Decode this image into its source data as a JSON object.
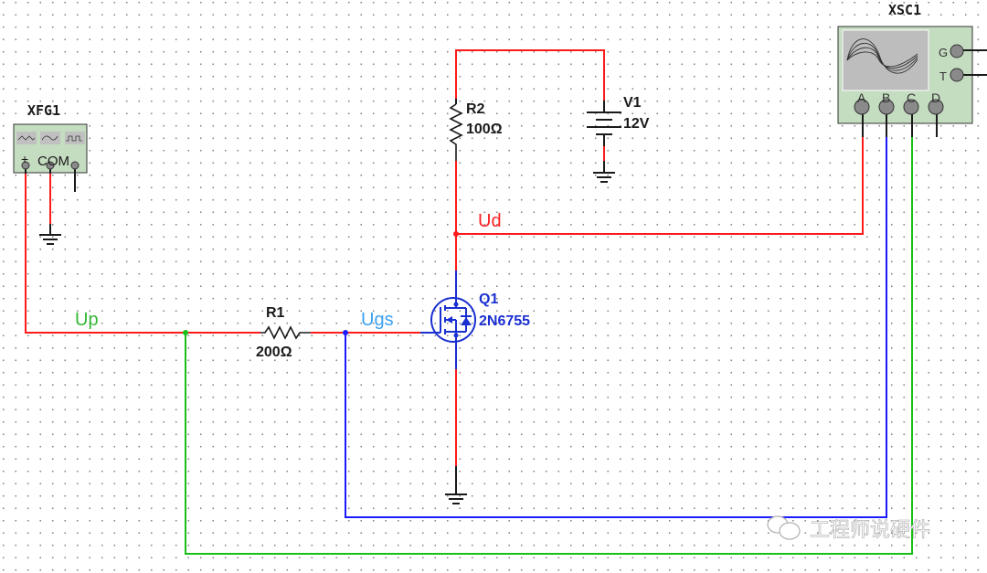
{
  "colors": {
    "wire_red": "#ff1a1a",
    "wire_blue": "#1a1aff",
    "wire_green": "#16c016",
    "component_black": "#1a1a1a",
    "mosfet_blue": "#1a2fd0",
    "label_up": "#33b833",
    "label_ugs": "#3ba0f0",
    "label_ud": "#ff2020",
    "instrument_fill": "#c4dcc0",
    "screen_fill": "#bdbdbd",
    "terminal_fill": "#8a8a8a",
    "watermark": "#b0b0b0"
  },
  "components": {
    "function_generator": {
      "name": "XFG1",
      "waveform_buttons": [
        "triangle-wave",
        "sine-wave",
        "square-wave"
      ],
      "terminal_plus": "+",
      "terminal_com": "COM",
      "terminal_minus": "-"
    },
    "oscilloscope": {
      "name": "XSC1",
      "channels": [
        "A",
        "B",
        "C",
        "D"
      ],
      "side_terminals": [
        "G",
        "T"
      ]
    },
    "r1": {
      "ref": "R1",
      "value": "200Ω"
    },
    "r2": {
      "ref": "R2",
      "value": "100Ω"
    },
    "v1": {
      "ref": "V1",
      "value": "12V"
    },
    "q1": {
      "ref": "Q1",
      "model": "2N6755"
    }
  },
  "net_labels": {
    "up": "Up",
    "ugs": "Ugs",
    "ud": "Ud"
  },
  "watermark": {
    "text": "工程师说硬件"
  }
}
